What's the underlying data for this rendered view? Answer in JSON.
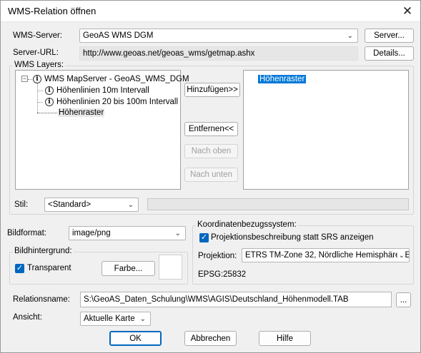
{
  "window": {
    "title": "WMS-Relation öffnen",
    "close_glyph": "✕"
  },
  "server": {
    "label": "WMS-Server:",
    "value": "GeoAS WMS DGM",
    "button": "Server...",
    "url_label": "Server-URL:",
    "url": "http://www.geoas.net/geoas_wms/getmap.ashx",
    "details_button": "Details..."
  },
  "layers": {
    "group_title": "WMS Layers:",
    "root": "WMS MapServer - GeoAS_WMS_DGM",
    "children": [
      "Höhenlinien 10m Intervall",
      "Höhenlinien 20 bis 100m Intervall",
      "Höhenraster"
    ],
    "selected": [
      "Höhenraster"
    ],
    "add_button": "Hinzufügen>>",
    "remove_button": "Entfernen<<",
    "up_button": "Nach oben",
    "down_button": "Nach unten",
    "style_label": "Stil:",
    "style_value": "<Standard>"
  },
  "image": {
    "format_label": "Bildformat:",
    "format_value": "image/png",
    "background_group": "Bildhintergrund:",
    "transparent_label": "Transparent",
    "transparent_checked": true,
    "color_button": "Farbe..."
  },
  "crs": {
    "group_title": "Koordinatenbezugssystem:",
    "projdesc_label": "Projektionsbeschreibung statt SRS anzeigen",
    "projdesc_checked": true,
    "projection_label": "Projektion:",
    "projection_value": "ETRS TM-Zone 32, Nördliche Hemisphäre (E",
    "epsg": "EPSG:25832"
  },
  "relation": {
    "name_label": "Relationsname:",
    "name_value": "S:\\GeoAS_Daten_Schulung\\WMS\\AGIS\\Deutschland_Höhenmodell.TAB",
    "browse_button": "...",
    "view_label": "Ansicht:",
    "view_value": "Aktuelle Karte"
  },
  "footer": {
    "ok": "OK",
    "cancel": "Abbrechen",
    "help": "Hilfe"
  },
  "colors": {
    "accent": "#0067c0",
    "selection": "#0078d7"
  }
}
